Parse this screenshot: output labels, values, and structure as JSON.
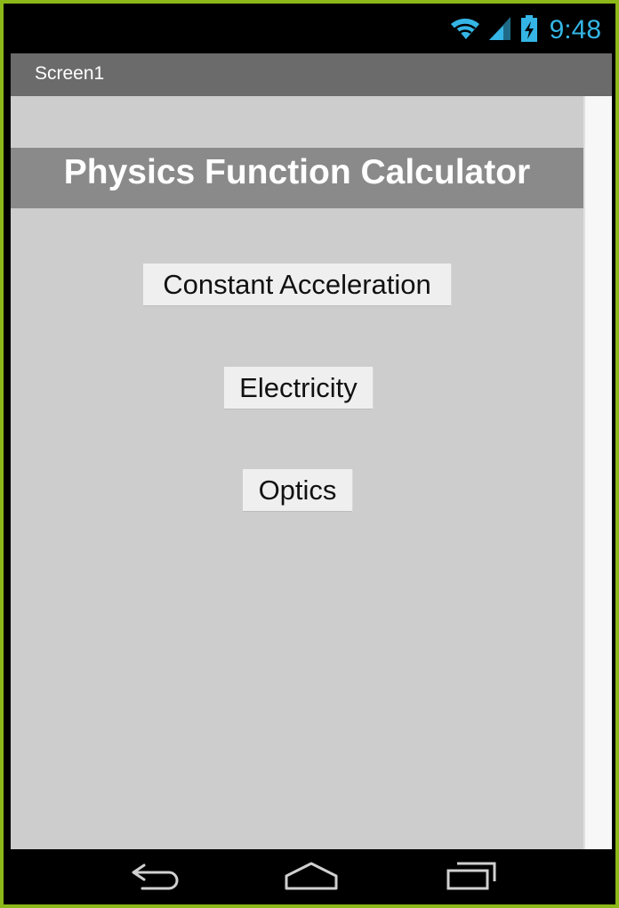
{
  "status_bar": {
    "time": "9:48",
    "icons": [
      "wifi-icon",
      "signal-icon",
      "battery-charging-icon"
    ],
    "accent_color": "#35b5e5"
  },
  "title_bar": {
    "title": "Screen1"
  },
  "main": {
    "heading": "Physics Function Calculator",
    "buttons": [
      {
        "label": "Constant Acceleration"
      },
      {
        "label": "Electricity"
      },
      {
        "label": "Optics"
      }
    ]
  },
  "nav_bar": {
    "icons": [
      "back-icon",
      "home-icon",
      "recent-apps-icon"
    ]
  },
  "colors": {
    "frame": "#8db819",
    "title_bar": "#6b6b6b",
    "content_bg": "#cdcdcd",
    "heading_bg": "#8a8a8a",
    "button_bg": "#efefef"
  }
}
